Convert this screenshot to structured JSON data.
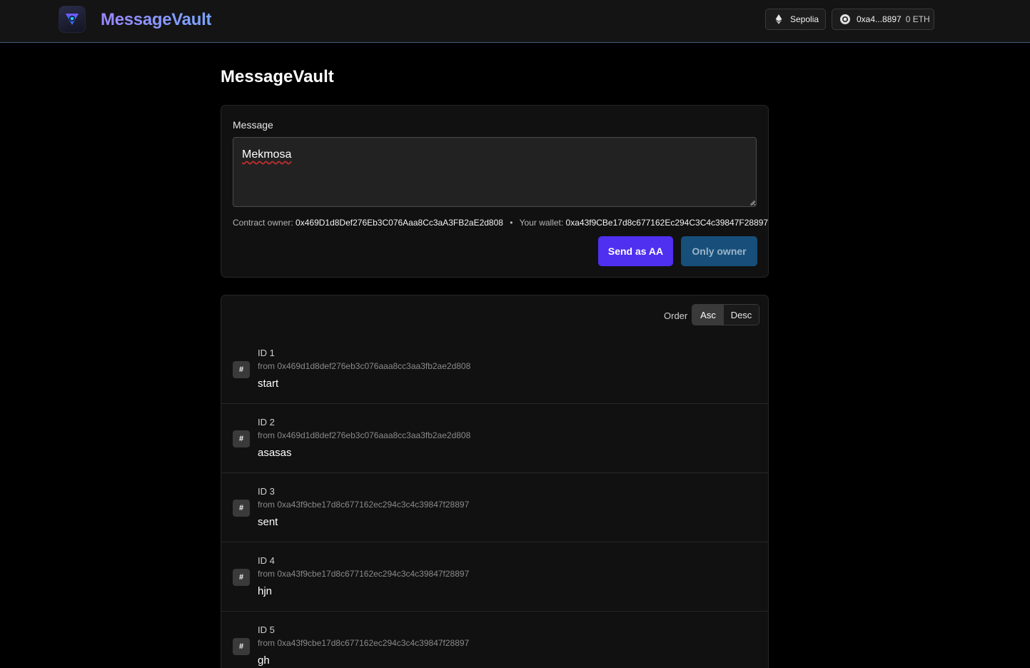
{
  "header": {
    "brand": "MessageVault",
    "network": "Sepolia",
    "wallet_short": "0xa4...8897",
    "balance": "0 ETH"
  },
  "page": {
    "title": "MessageVault"
  },
  "compose": {
    "label": "Message",
    "value": "Mekmosa",
    "owner_label": "Contract owner:",
    "owner_address": "0x469D1d8Def276Eb3C076Aaa8Cc3aA3FB2aE2d808",
    "wallet_label": "Your wallet:",
    "wallet_address": "0xa43f9CBe17d8c677162Ec294C3C4c39847F28897",
    "send_label": "Send as AA",
    "owner_button_label": "Only owner"
  },
  "list": {
    "order_label": "Order",
    "asc_label": "Asc",
    "desc_label": "Desc",
    "selected_order": "Asc",
    "hash_glyph": "#",
    "messages": [
      {
        "id": "ID 1",
        "from": "from 0x469d1d8def276eb3c076aaa8cc3aa3fb2ae2d808",
        "text": "start"
      },
      {
        "id": "ID 2",
        "from": "from 0x469d1d8def276eb3c076aaa8cc3aa3fb2ae2d808",
        "text": "asasas"
      },
      {
        "id": "ID 3",
        "from": "from 0xa43f9cbe17d8c677162ec294c3c4c39847f28897",
        "text": "sent"
      },
      {
        "id": "ID 4",
        "from": "from 0xa43f9cbe17d8c677162ec294c3c4c39847f28897",
        "text": "hjn"
      },
      {
        "id": "ID 5",
        "from": "from 0xa43f9cbe17d8c677162ec294c3c4c39847f28897",
        "text": "gh"
      }
    ]
  },
  "colors": {
    "accent": "#4f2ff0",
    "owner_button": "#174f7a",
    "brand_gradient_start": "#9a86ff",
    "brand_gradient_end": "#7aa6ff"
  }
}
